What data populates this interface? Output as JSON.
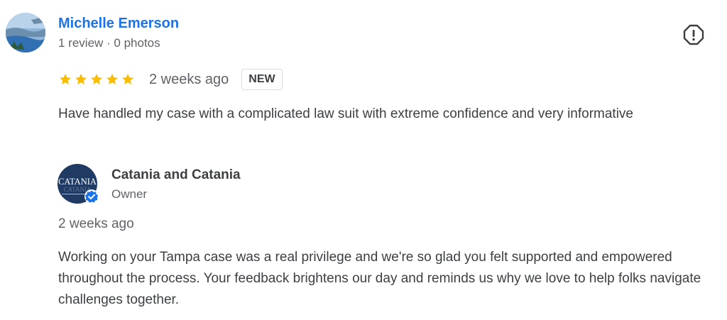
{
  "review": {
    "reviewer_name": "Michelle Emerson",
    "reviewer_meta": "1 review · 0 photos",
    "rating": 5,
    "max_rating": 5,
    "time": "2 weeks ago",
    "badge": "NEW",
    "text": "Have handled my case with a complicated law suit with extreme confidence and very informative",
    "report_icon": "report-flag-icon",
    "star_color": "#fbbc04"
  },
  "owner_reply": {
    "name": "Catania and Catania",
    "role": "Owner",
    "avatar_text": "CATANIA",
    "time": "2 weeks ago",
    "text": "Working on your Tampa case was a real privilege and we're so glad you felt supported and empowered throughout the process. Your feedback brightens our day and reminds us why we love to help folks navigate challenges together.",
    "verified_icon": "verified-badge-icon",
    "avatar_color": "#1f3b63"
  }
}
